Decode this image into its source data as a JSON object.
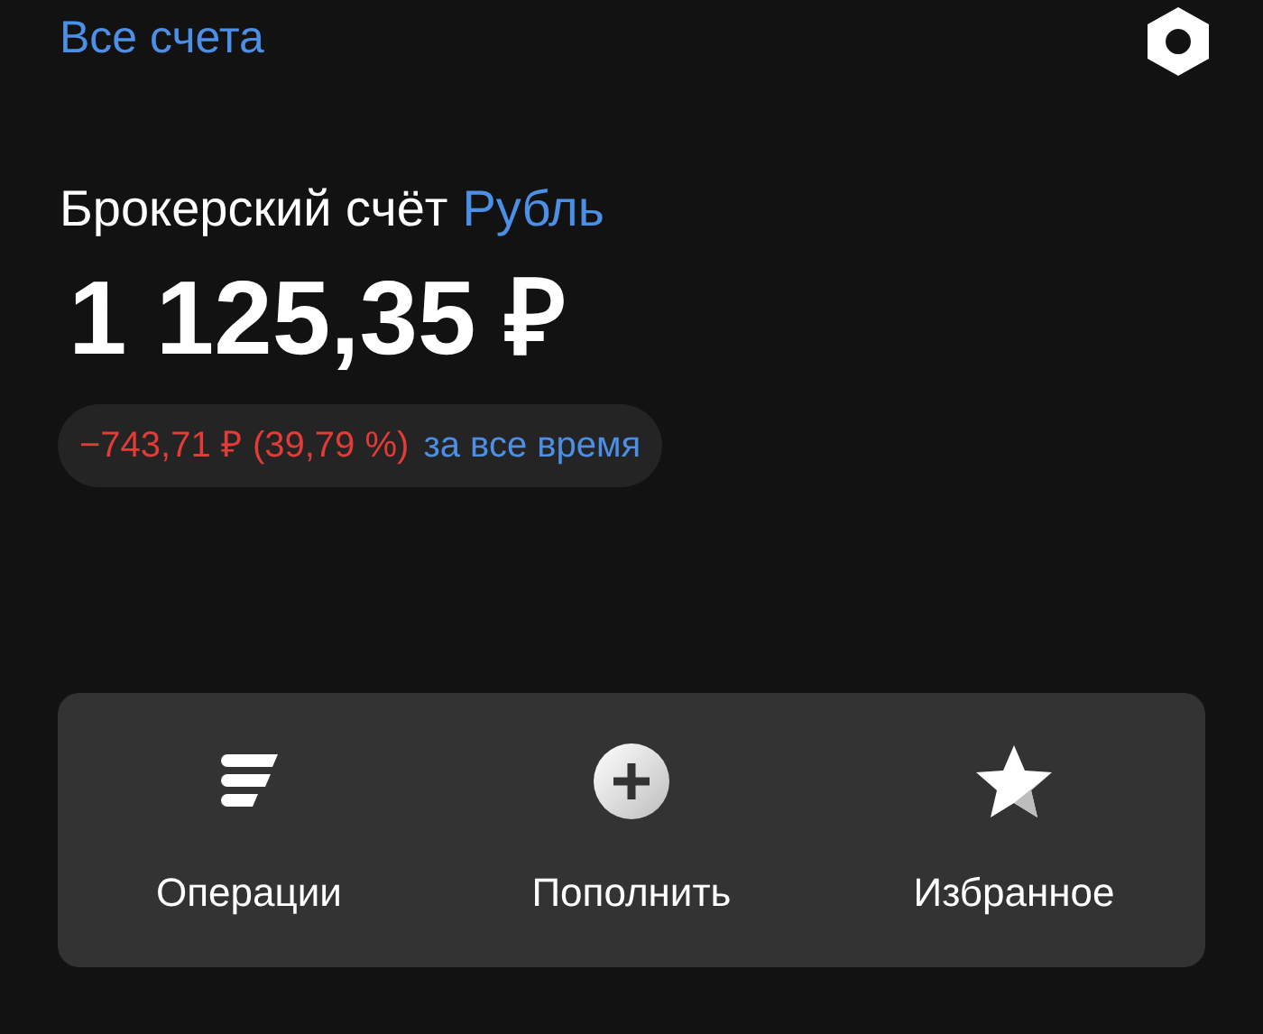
{
  "header": {
    "link": "Все счета"
  },
  "account": {
    "name": "Брокерский счёт",
    "currency": "Рубль",
    "balance": "1 125,35 ₽",
    "change": "−743,71 ₽ (39,79 %)",
    "period": "за все время"
  },
  "actions": [
    {
      "kind": "operations",
      "label": "Операции"
    },
    {
      "kind": "topup",
      "label": "Пополнить"
    },
    {
      "kind": "favorites",
      "label": "Избранное"
    }
  ]
}
